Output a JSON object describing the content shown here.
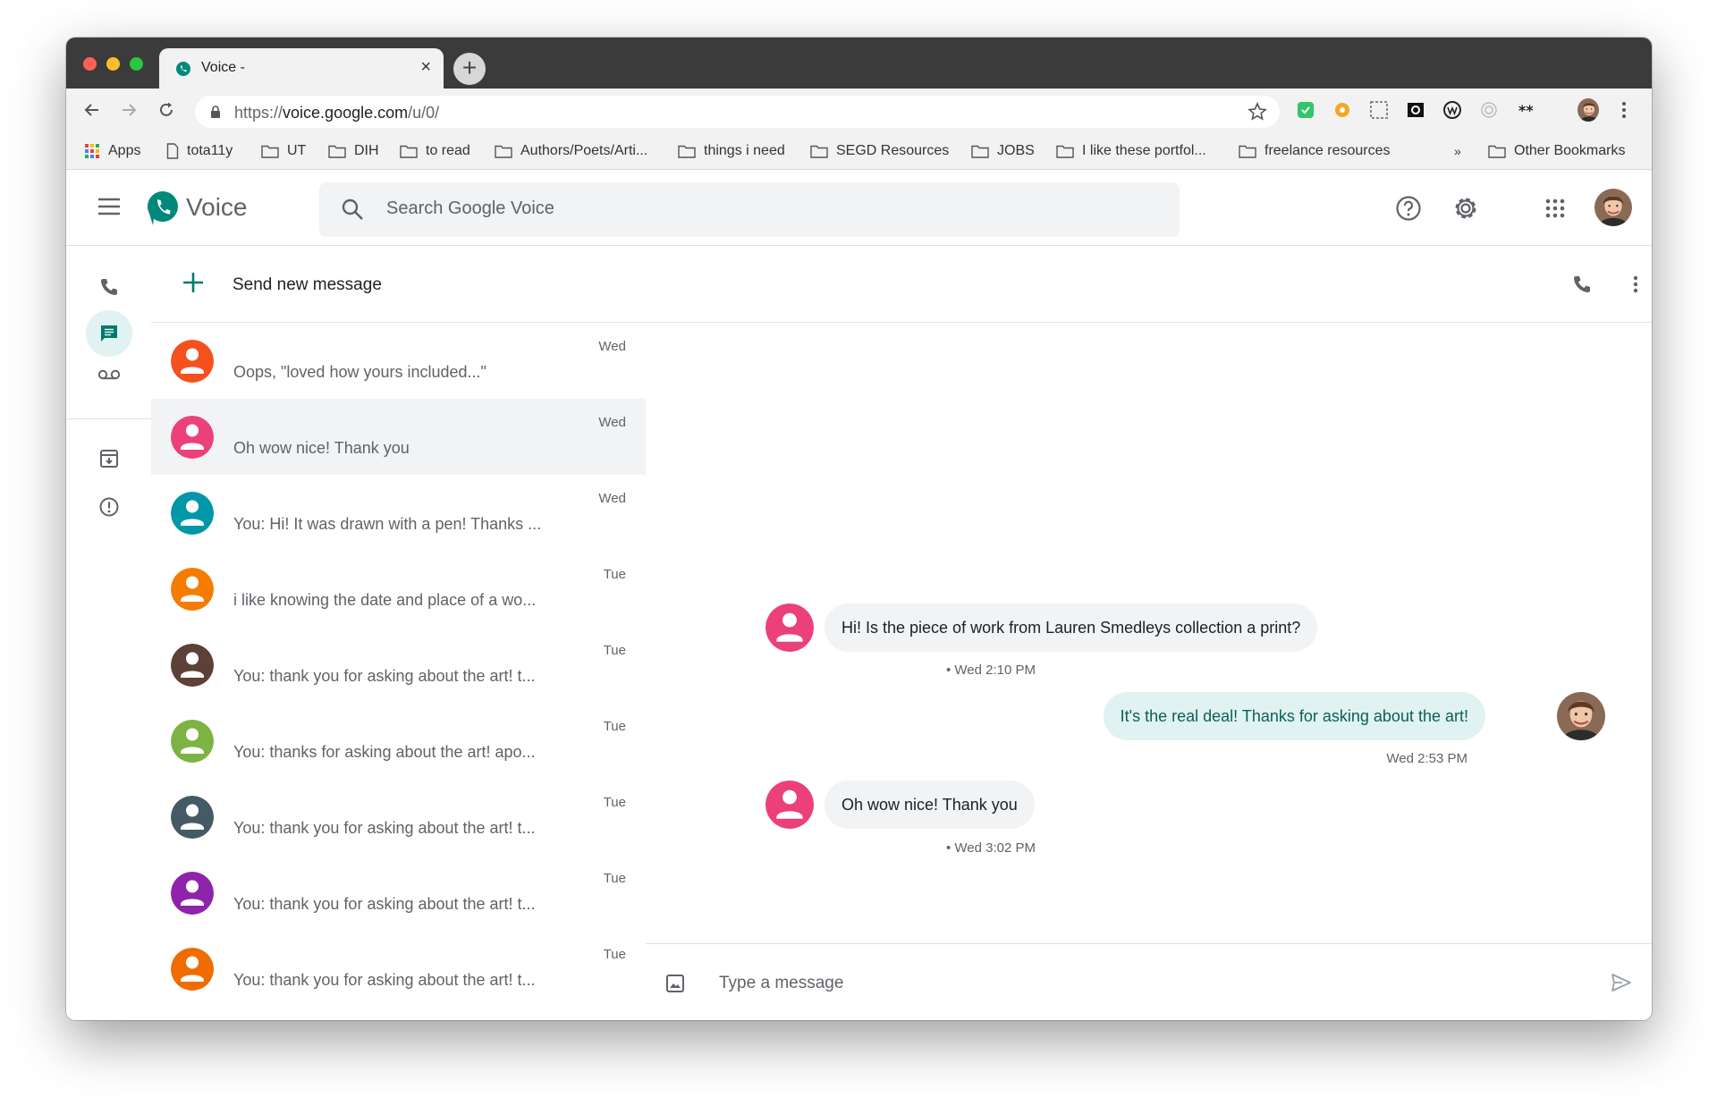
{
  "browser": {
    "tab_title": "Voice -",
    "tab_close": "×",
    "new_tab": "+",
    "url_scheme": "https://",
    "url_host": "voice.google.com",
    "url_path": "/u/0/",
    "bookmarks": [
      "Apps",
      "tota11y",
      "UT",
      "DIH",
      "to read",
      "Authors/Poets/Arti...",
      "things i need",
      "SEGD Resources",
      "JOBS",
      "I like these portfol...",
      "freelance resources"
    ],
    "bookmarks_overflow": "»",
    "other_bookmarks": "Other Bookmarks"
  },
  "app": {
    "name": "Voice",
    "search_placeholder": "Search Google Voice",
    "brand_color": "#00897b"
  },
  "nav_rail": {
    "items": [
      "calls",
      "messages",
      "voicemail",
      "archive",
      "spam"
    ],
    "active": "messages"
  },
  "threads": {
    "send_new_label": "Send new message",
    "items": [
      {
        "time": "Wed",
        "snippet": "Oops, \"loved how yours included...\"",
        "color": "#f4511e"
      },
      {
        "time": "Wed",
        "snippet": "Oh wow nice! Thank you",
        "color": "#ec407a",
        "selected": true
      },
      {
        "time": "Wed",
        "snippet": "You: Hi! It was drawn with a pen! Thanks ...",
        "color": "#0097a7"
      },
      {
        "time": "Tue",
        "snippet": "i like knowing the date and place of a wo...",
        "color": "#f57c00"
      },
      {
        "time": "Tue",
        "snippet": "You: thank you for asking about the art! t...",
        "color": "#5d4037"
      },
      {
        "time": "Tue",
        "snippet": "You: thanks for asking about the art! apo...",
        "color": "#7cb342"
      },
      {
        "time": "Tue",
        "snippet": "You: thank you for asking about the art! t...",
        "color": "#455a64"
      },
      {
        "time": "Tue",
        "snippet": "You: thank you for asking about the art! t...",
        "color": "#8e24aa"
      },
      {
        "time": "Tue",
        "snippet": "You: thank you for asking about the art! t...",
        "color": "#ef6c00"
      }
    ]
  },
  "conversation": {
    "contact_color": "#ec407a",
    "messages": [
      {
        "direction": "incoming",
        "text": "Hi! Is the piece of work from Lauren Smedleys collection a print?",
        "stamp": "• Wed 2:10 PM"
      },
      {
        "direction": "outgoing",
        "text": "It's the real deal! Thanks for asking about the art!",
        "stamp": "Wed 2:53 PM"
      },
      {
        "direction": "incoming",
        "text": "Oh wow nice! Thank you",
        "stamp": "• Wed 3:02 PM"
      }
    ],
    "composer_placeholder": "Type a message"
  }
}
